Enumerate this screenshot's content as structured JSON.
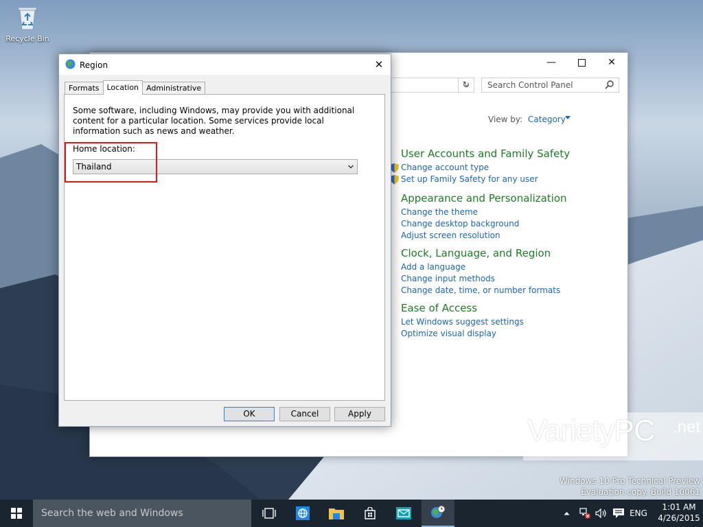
{
  "desktop": {
    "recycle_bin_label": "Recycle Bin"
  },
  "control_panel": {
    "search_placeholder": "Search Control Panel",
    "view_by_label": "View by:",
    "view_by_value": "Category",
    "categories": [
      {
        "title": "User Accounts and Family Safety",
        "links": [
          "Change account type",
          "Set up Family Safety for any user"
        ]
      },
      {
        "title": "Appearance and Personalization",
        "links": [
          "Change the theme",
          "Change desktop background",
          "Adjust screen resolution"
        ]
      },
      {
        "title": "Clock, Language, and Region",
        "links": [
          "Add a language",
          "Change input methods",
          "Change date, time, or number formats"
        ]
      },
      {
        "title": "Ease of Access",
        "links": [
          "Let Windows suggest settings",
          "Optimize visual display"
        ]
      }
    ],
    "colors": {
      "category_title": "#1e7b24",
      "link": "#1a65b5"
    }
  },
  "region_dialog": {
    "title": "Region",
    "tabs": [
      "Formats",
      "Location",
      "Administrative"
    ],
    "active_tab": "Location",
    "description": "Some software, including Windows, may provide you with additional content for a particular location. Some services provide local information such as news and weather.",
    "home_location_label": "Home location:",
    "home_location_value": "Thailand",
    "buttons": {
      "ok": "OK",
      "cancel": "Cancel",
      "apply": "Apply"
    },
    "highlight_color": "#e0161a"
  },
  "watermark": {
    "brand": "VarietyPC",
    "brand_suffix": ".net",
    "build_line1": "Windows 10 Pro Technical Preview",
    "build_line2": "Evaluation copy. Build 10061"
  },
  "taskbar": {
    "search_placeholder": "Search the web and Windows",
    "language": "ENG",
    "time": "1:01 AM",
    "date": "4/26/2015"
  }
}
